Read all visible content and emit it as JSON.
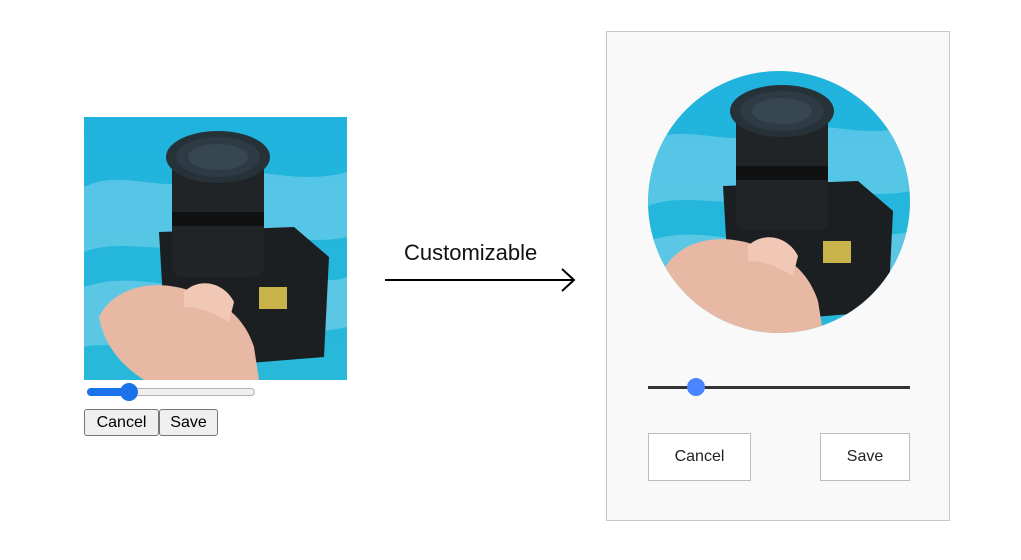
{
  "left_cropper": {
    "zoom_slider": {
      "value_fraction": 0.22
    },
    "cancel_label": "Cancel",
    "save_label": "Save"
  },
  "arrow": {
    "label": "Customizable"
  },
  "right_cropper": {
    "zoom_slider": {
      "value_fraction": 0.16
    },
    "cancel_label": "Cancel",
    "save_label": "Save"
  },
  "colors": {
    "sky": "#2bb6dc",
    "native_accent": "#1a73e8",
    "custom_thumb": "#4b84ff",
    "custom_track": "#333333",
    "panel_bg": "#f9f9f9"
  }
}
